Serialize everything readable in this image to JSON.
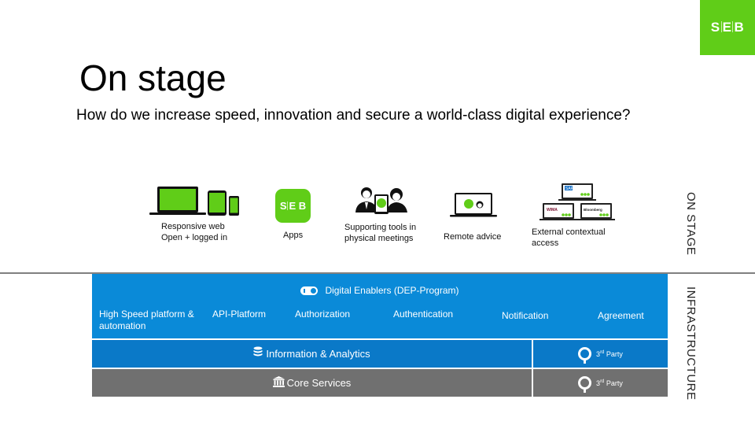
{
  "brand": {
    "logo_parts": [
      "S",
      "E",
      "B"
    ],
    "accent_color": "#60cd18"
  },
  "header": {
    "title": "On stage",
    "subtitle": "How do we increase speed, innovation and secure a world-class digital experience?"
  },
  "on_stage": {
    "section_label": "ON STAGE",
    "items": [
      {
        "icon": "devices-icon",
        "label_line1": "Responsive web",
        "label_line2": "Open + logged in"
      },
      {
        "icon": "seb-app-icon",
        "label_line1": "Apps",
        "app_logo_parts": [
          "S",
          "E",
          "B"
        ]
      },
      {
        "icon": "advisor-meeting-icon",
        "label_line1": "Supporting tools in",
        "label_line2": "physical meetings"
      },
      {
        "icon": "remote-advice-icon",
        "label_line1": "Remote advice"
      },
      {
        "icon": "external-access-icon",
        "label_line1": "External contextual",
        "label_line2": "access",
        "partner_logos": [
          "SAP",
          "WIMA",
          "Bloomberg"
        ]
      }
    ]
  },
  "infrastructure": {
    "section_label": "INFRASTRUCTURE",
    "dep": {
      "title": "Digital Enablers (DEP-Program)",
      "items": [
        {
          "line1": "High Speed platform &",
          "line2": "automation"
        },
        {
          "line1": "API-Platform"
        },
        {
          "line1": "Authorization"
        },
        {
          "line1": "Authentication"
        },
        {
          "line1": "Notification"
        },
        {
          "line1": "Agreement"
        }
      ],
      "color": "#0a8ad8"
    },
    "rows": [
      {
        "icon": "database-icon",
        "label": "Information & Analytics",
        "third_party": {
          "number": "3",
          "suffix": "rd",
          "label": "Party"
        },
        "color": "#0a79c8"
      },
      {
        "icon": "bank-icon",
        "label": "Core Services",
        "third_party": {
          "number": "3",
          "suffix": "rd",
          "label": "Party"
        },
        "color": "#707070"
      }
    ]
  }
}
